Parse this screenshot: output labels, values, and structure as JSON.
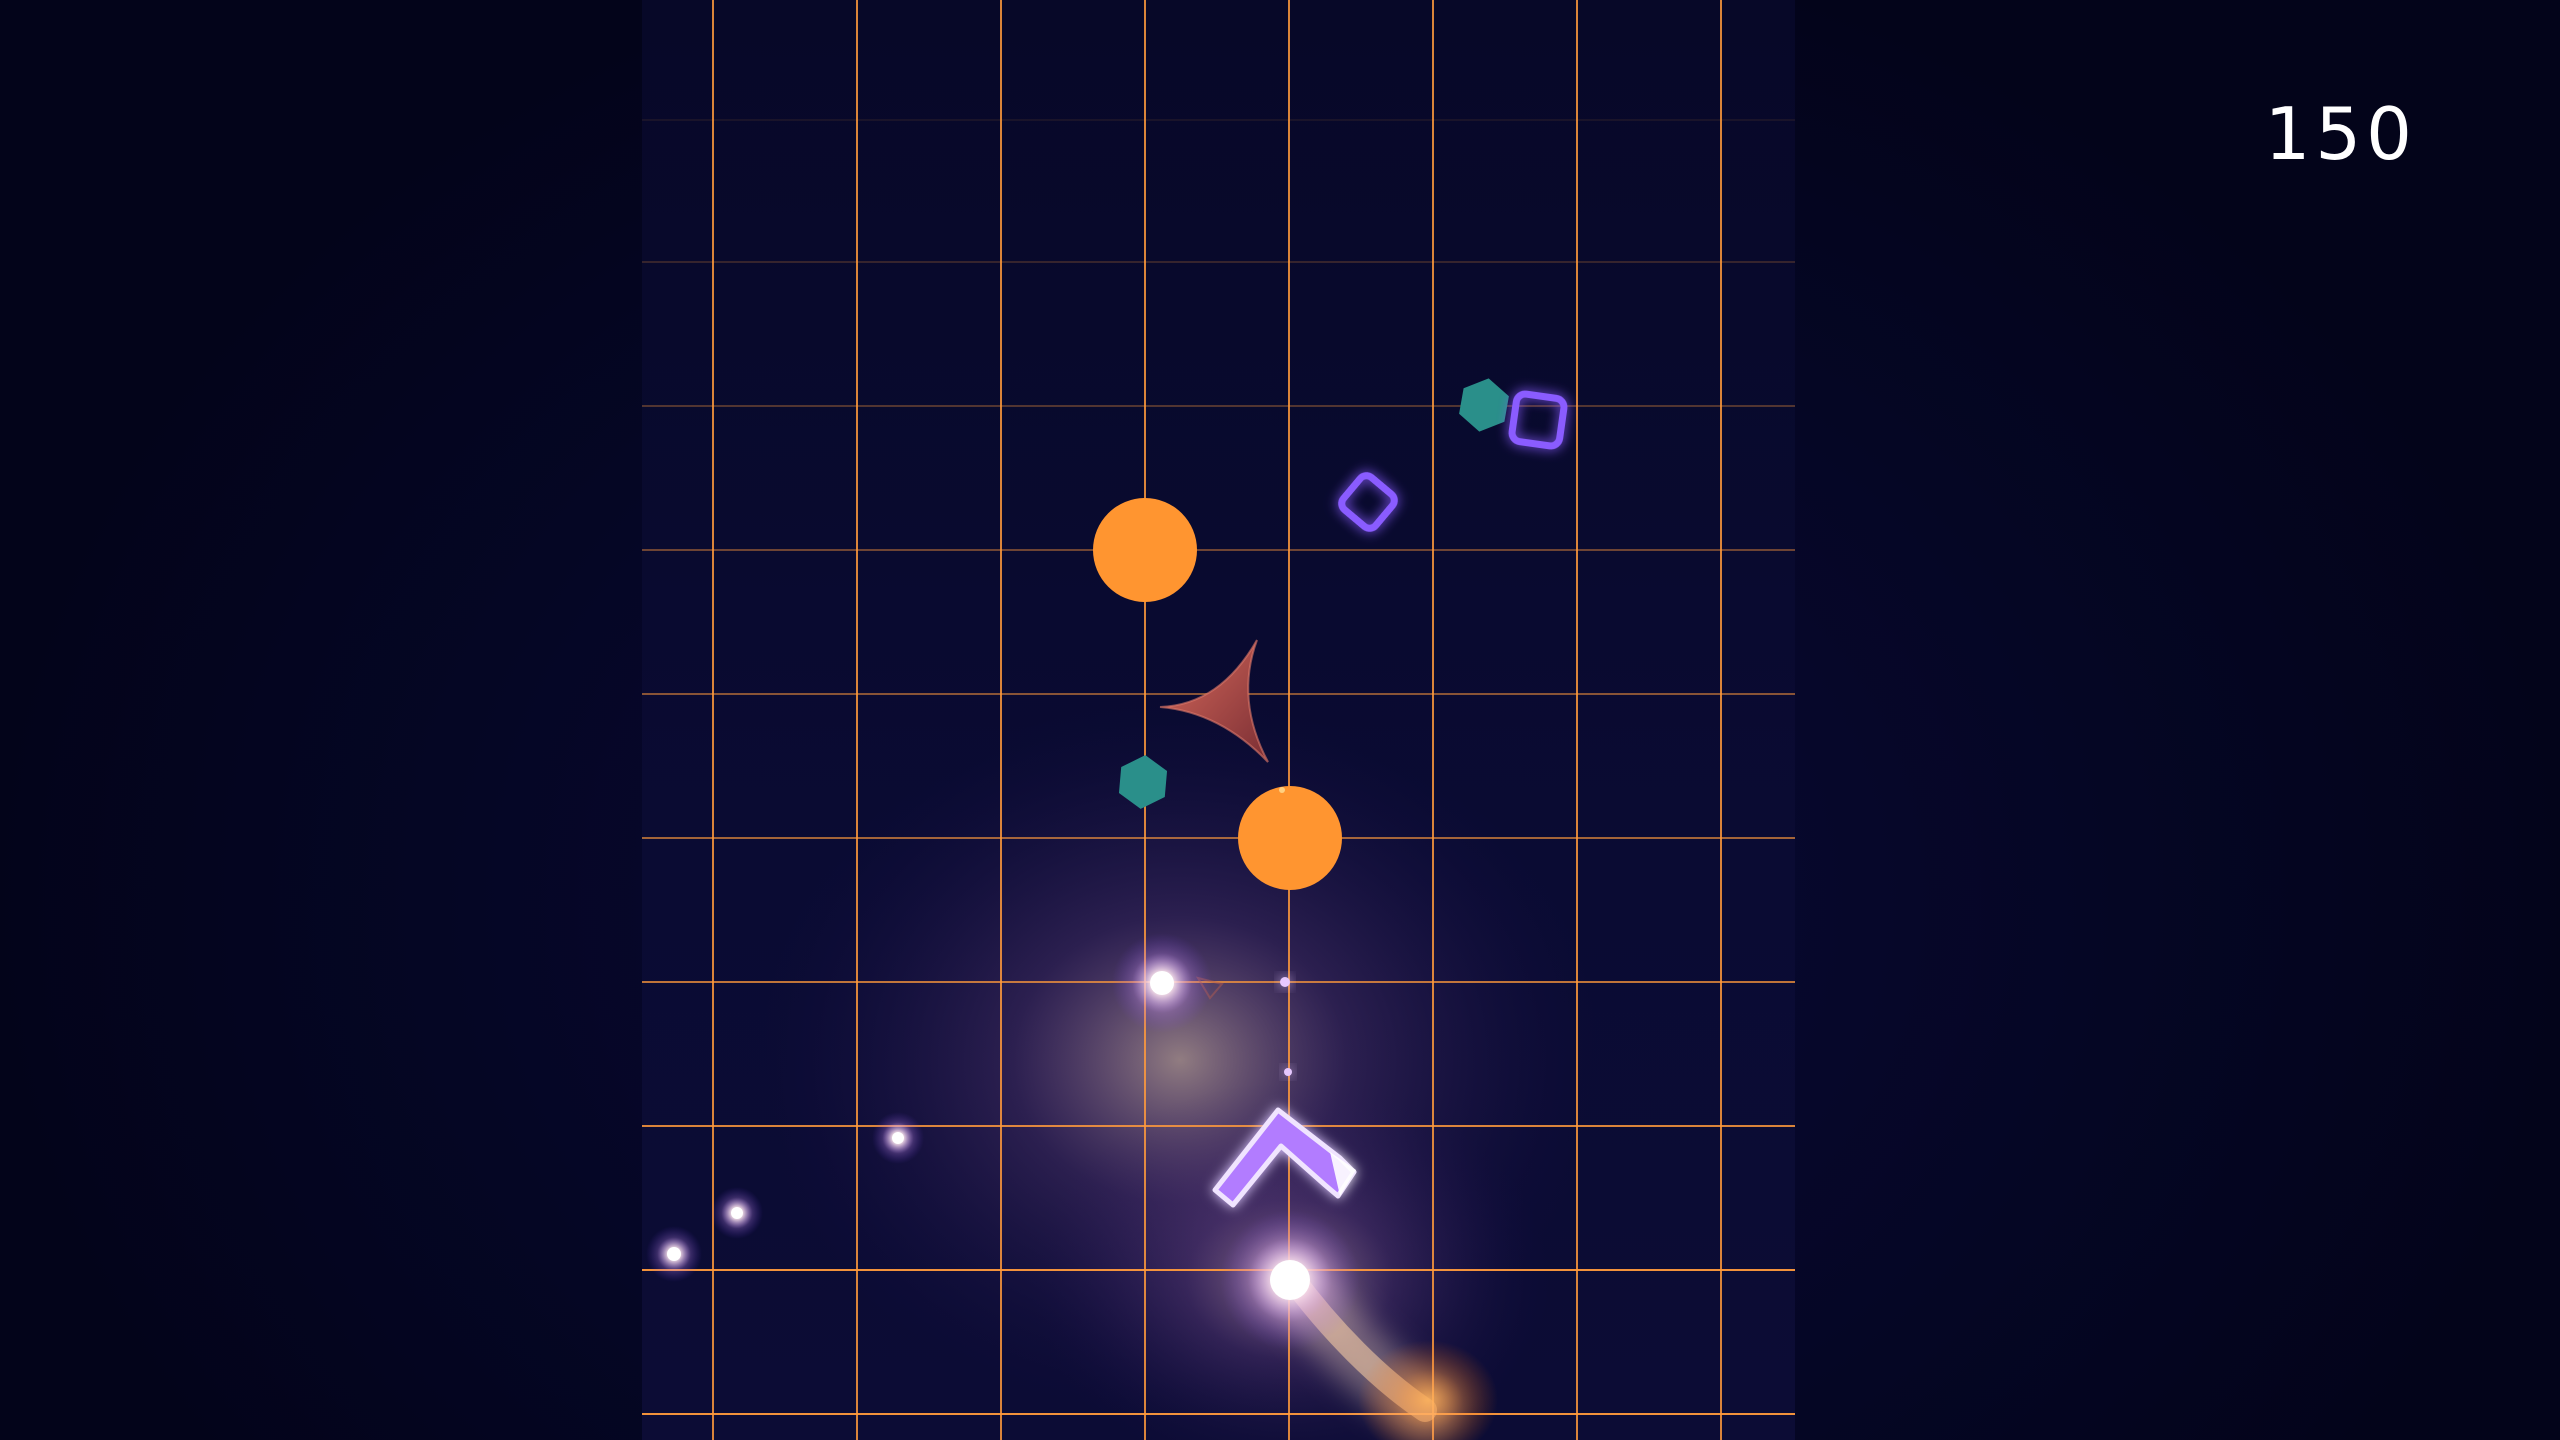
{
  "hud": {
    "score": "150"
  },
  "palette": {
    "background": "#04051a",
    "playfield": "#0a0b33",
    "grid_line": "#ff9a3c",
    "orb": "#ff9530",
    "hexagon": "#2a8f8a",
    "ring": "#8a5cff",
    "spike_enemy": "#b54a45",
    "player_fill": "#b27cff",
    "player_outline": "#f0e4ff",
    "spark": "#ffffff"
  },
  "entities": {
    "player": {
      "type": "chevron-ship"
    },
    "orbs": [
      {
        "type": "orange-orb"
      },
      {
        "type": "orange-orb"
      }
    ],
    "hexagons": [
      {
        "type": "teal-hexagon"
      },
      {
        "type": "teal-hexagon"
      }
    ],
    "rings": [
      {
        "type": "violet-square-ring"
      },
      {
        "type": "violet-square-ring"
      }
    ],
    "enemies": [
      {
        "type": "red-spike-enemy"
      }
    ],
    "sparks": [
      {
        "type": "spark"
      },
      {
        "type": "spark"
      },
      {
        "type": "spark"
      },
      {
        "type": "spark"
      },
      {
        "type": "spark"
      }
    ]
  }
}
